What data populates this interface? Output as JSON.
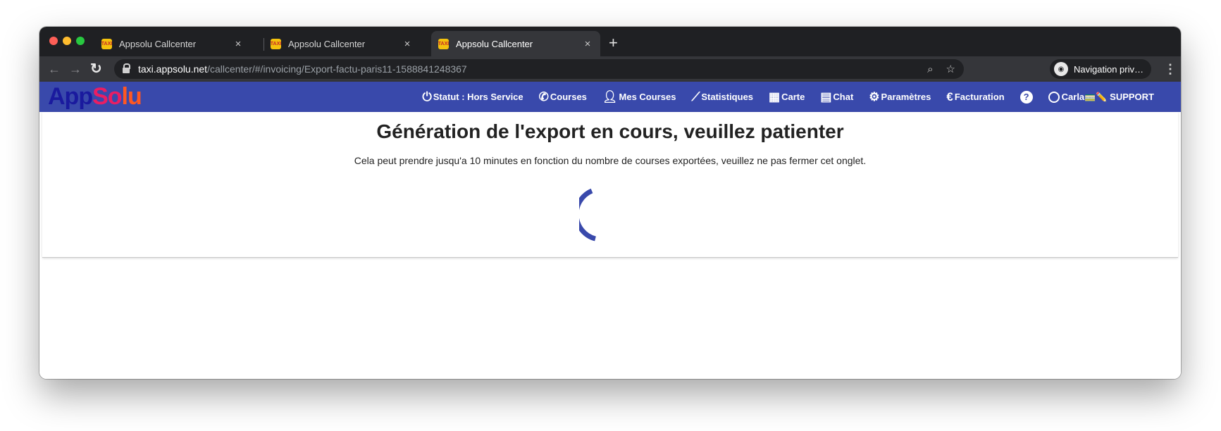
{
  "browser": {
    "tabs": [
      {
        "title": "Appsolu Callcenter",
        "favicon_text": "TAXI",
        "active": false
      },
      {
        "title": "Appsolu Callcenter",
        "favicon_text": "TAXI",
        "active": false
      },
      {
        "title": "Appsolu Callcenter",
        "favicon_text": "TAXI",
        "active": true
      }
    ],
    "tab_close": "×",
    "new_tab": "+",
    "url_host": "taxi.appsolu.net",
    "url_path": "/callcenter/#/invoicing/Export-factu-paris11-1588841248367",
    "profile_label": "Navigation priv…"
  },
  "app": {
    "logo": {
      "part1": "App",
      "part2": "So",
      "part3": "lu"
    },
    "nav": {
      "status": "Statut : Hors Service",
      "courses": "Courses",
      "mes_courses": "Mes Courses",
      "statistiques": "Statistiques",
      "carte": "Carte",
      "chat": "Chat",
      "parametres": "Paramètres",
      "facturation": "Facturation",
      "help": "?",
      "user": "Carla🚃✏️ SUPPORT"
    },
    "accent_color": "#3949ab"
  },
  "main": {
    "heading": "Génération de l'export en cours, veuillez patienter",
    "subtext": "Cela peut prendre jusqu'a 10 minutes en fonction du nombre de courses exportées, veuillez ne pas fermer cet onglet."
  }
}
